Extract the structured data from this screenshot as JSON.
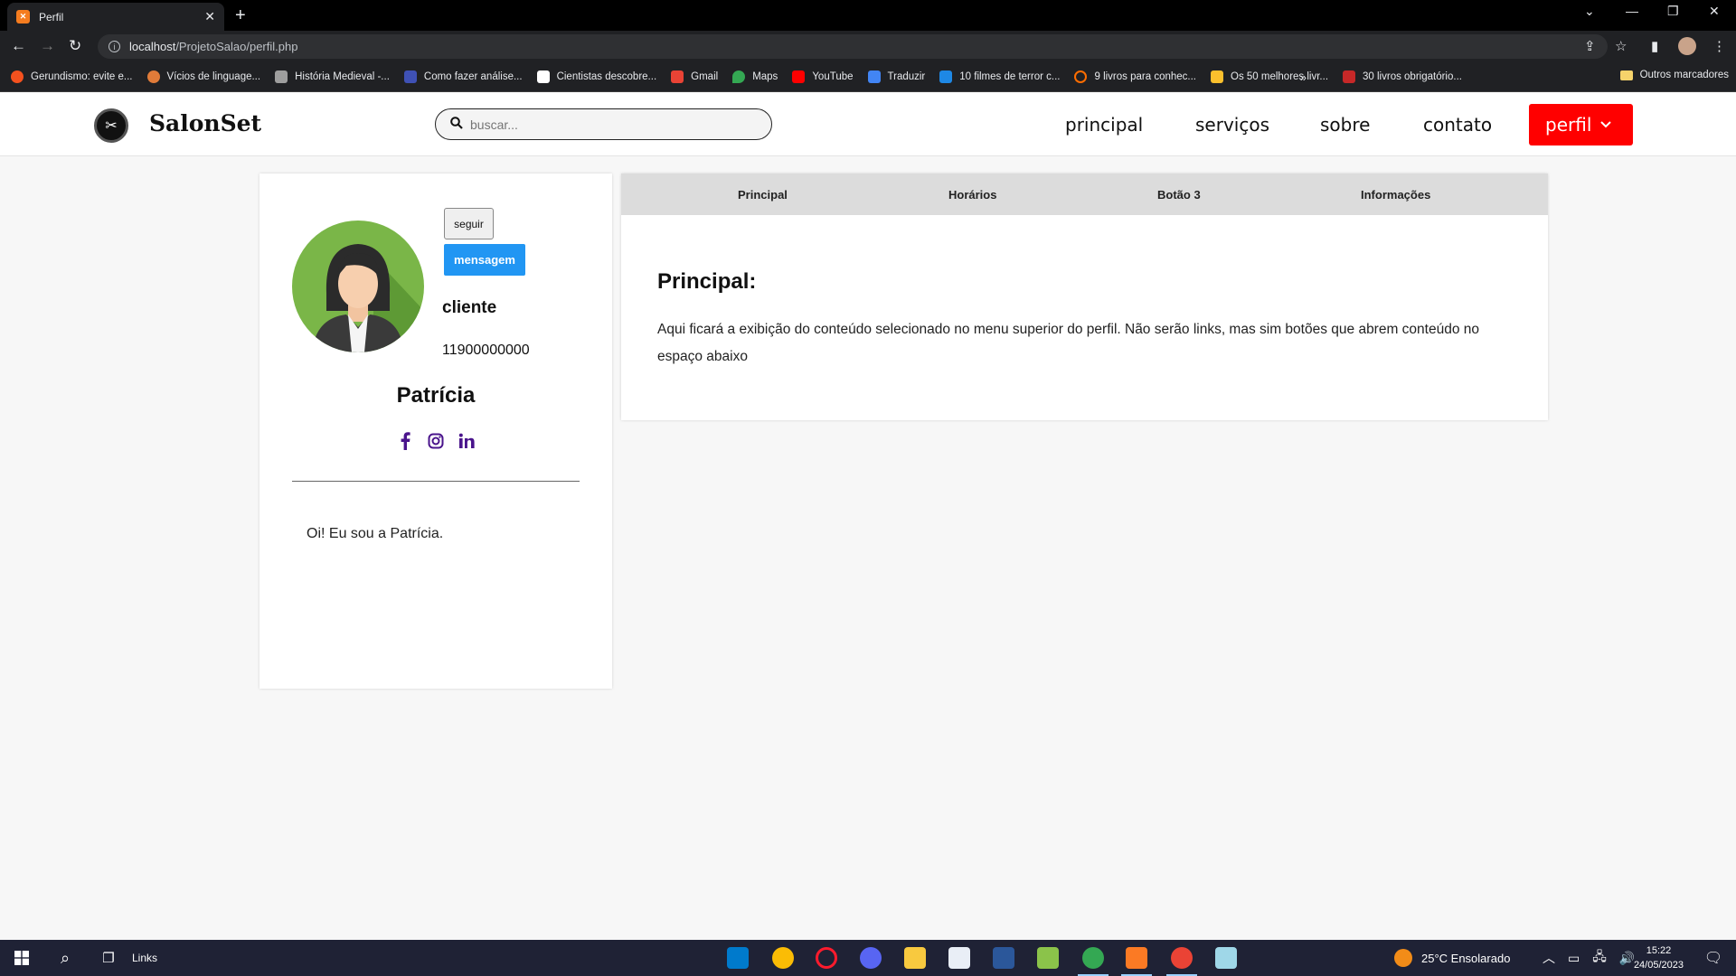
{
  "browser": {
    "tab_title": "Perfil",
    "url_host": "localhost",
    "url_path": "/ProjetoSalao/perfil.php",
    "bookmarks": [
      {
        "label": "Gerundismo: evite e...",
        "color": "#f4511e"
      },
      {
        "label": "Vícios de linguage...",
        "color": "#e07b39"
      },
      {
        "label": "História Medieval -...",
        "color": "#9e9e9e"
      },
      {
        "label": "Como fazer análise...",
        "color": "#3f51b5"
      },
      {
        "label": "Cientistas descobre...",
        "color": "#ffffff"
      },
      {
        "label": "Gmail",
        "color": "#ea4335"
      },
      {
        "label": "Maps",
        "color": "#34a853"
      },
      {
        "label": "YouTube",
        "color": "#ff0000"
      },
      {
        "label": "Traduzir",
        "color": "#4285f4"
      },
      {
        "label": "10 filmes de terror c...",
        "color": "#1e88e5"
      },
      {
        "label": "9 livros para conhec...",
        "color": "#ff6d00"
      },
      {
        "label": "Os 50 melhores livr...",
        "color": "#fbc02d"
      },
      {
        "label": "30 livros obrigatório...",
        "color": "#c62828"
      }
    ],
    "bookmarks_other": "Outros marcadores"
  },
  "site": {
    "brand": "SalonSet",
    "search_placeholder": "buscar...",
    "nav": [
      "principal",
      "serviços",
      "sobre",
      "contato"
    ],
    "profile_button": "perfil",
    "accent_color": "#ff0000"
  },
  "profile": {
    "follow_label": "seguir",
    "message_label": "mensagem",
    "role": "cliente",
    "phone": "11900000000",
    "name": "Patrícia",
    "socials": [
      "facebook-icon",
      "instagram-icon",
      "linkedin-icon"
    ],
    "bio": "Oi! Eu sou a Patrícia."
  },
  "panel": {
    "tabs": [
      "Principal",
      "Horários",
      "Botão 3",
      "Informações"
    ],
    "title": "Principal:",
    "text": "Aqui ficará a exibição do conteúdo selecionado no menu superior do perfil. Não serão links, mas sim botões que abrem conteúdo no espaço abaixo"
  },
  "taskbar": {
    "links_label": "Links",
    "weather": "25°C  Ensolarado",
    "time": "15:22",
    "date": "24/05/2023"
  }
}
